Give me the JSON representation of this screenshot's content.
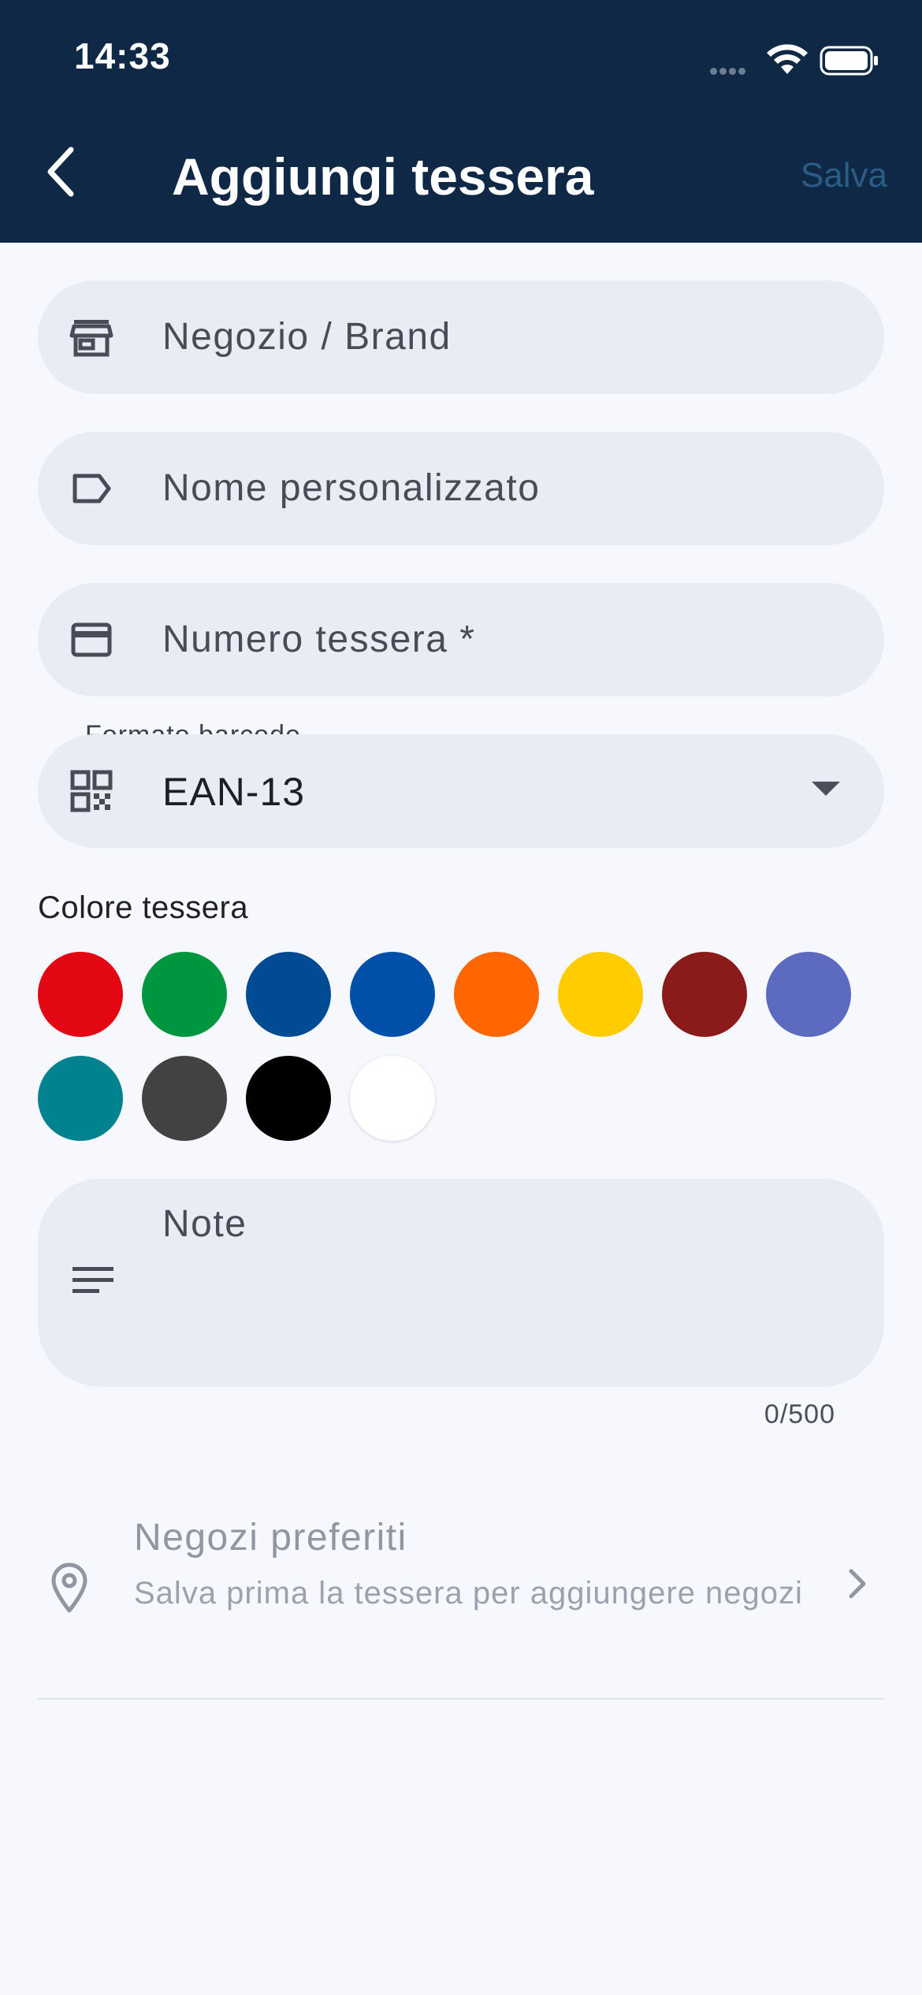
{
  "status_bar": {
    "time": "14:33"
  },
  "header": {
    "title": "Aggiungi tessera",
    "save_label": "Salva"
  },
  "fields": {
    "store_placeholder": "Negozio / Brand",
    "custom_name_placeholder": "Nome personalizzato",
    "card_number_placeholder": "Numero tessera *",
    "barcode_format_label": "Formato barcode",
    "barcode_format_value": "EAN-13"
  },
  "color_section": {
    "label": "Colore tessera",
    "colors": [
      "#e30613",
      "#00963f",
      "#004b93",
      "#0050aa",
      "#ff6600",
      "#ffcc00",
      "#8b1a1a",
      "#5c6bc0",
      "#00838f",
      "#424242",
      "#000000",
      "#ffffff"
    ]
  },
  "note": {
    "placeholder": "Note",
    "counter": "0/500"
  },
  "favorite_stores": {
    "title": "Negozi preferiti",
    "subtitle": "Salva prima la tessera per aggiungere negozi"
  },
  "icons": {
    "back": "chevron-left-icon",
    "store": "store-icon",
    "label": "label-icon",
    "card": "credit-card-icon",
    "qr": "qr-code-icon",
    "dropdown": "arrow-drop-down-icon",
    "notes": "notes-icon",
    "location": "location-pin-icon",
    "chevron": "chevron-right-icon"
  },
  "theme": {
    "header_bg": "#0f2845",
    "field_bg": "#e8ecf4",
    "page_bg": "#f6f8fd",
    "save_color": "#2b5c86"
  }
}
